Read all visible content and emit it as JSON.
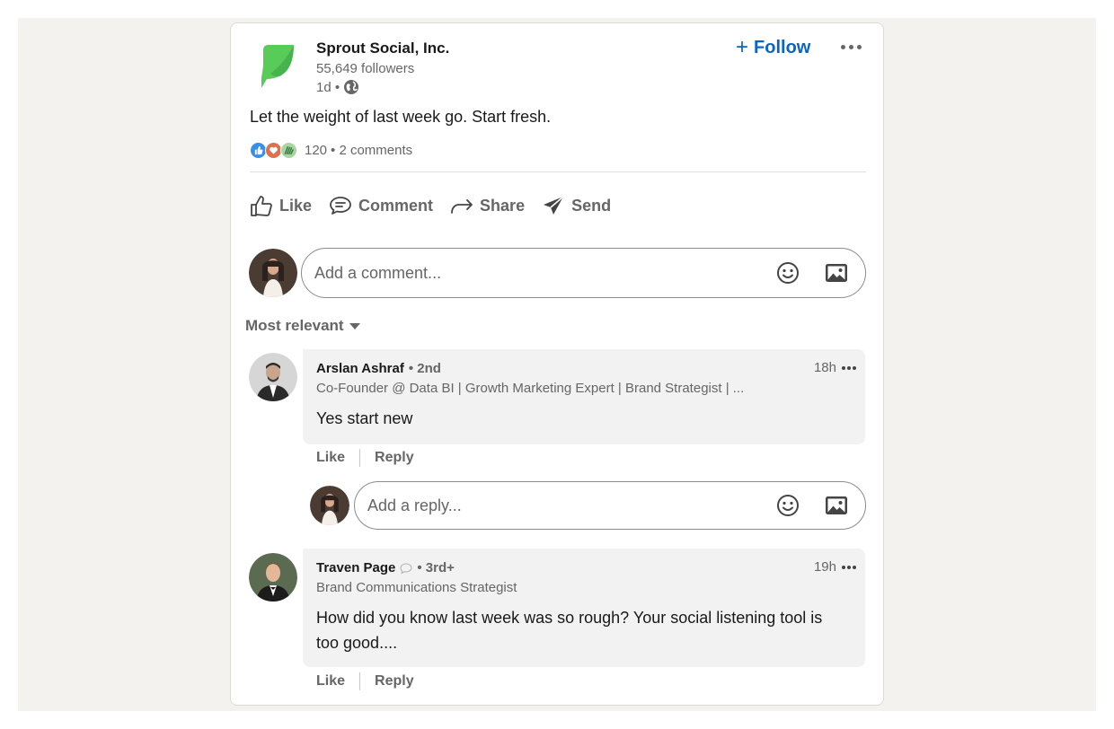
{
  "post": {
    "company": "Sprout Social, Inc.",
    "followers": "55,649 followers",
    "age": "1d •",
    "follow_label": "Follow",
    "text": "Let the weight of last week go. Start fresh.",
    "reaction_count": "120",
    "comments_count": "• 2 comments",
    "brand_color": "#59cb59",
    "accent_color": "#0a66c2"
  },
  "actions": {
    "like": "Like",
    "comment": "Comment",
    "share": "Share",
    "send": "Send"
  },
  "composer": {
    "placeholder": "Add a comment...",
    "sort_label": "Most relevant"
  },
  "comments": [
    {
      "name": "Arslan Ashraf",
      "degree": "• 2nd",
      "headline": "Co-Founder @ Data BI | Growth Marketing Expert | Brand Strategist | ...",
      "time": "18h",
      "body": "Yes start new",
      "like": "Like",
      "reply": "Reply",
      "reply_placeholder": "Add a reply..."
    },
    {
      "name": "Traven Page",
      "degree": "• 3rd+",
      "headline": "Brand Communications Strategist",
      "time": "19h",
      "body": "How did you know last week was so rough? Your social listening tool is too good....",
      "like": "Like",
      "reply": "Reply"
    }
  ]
}
